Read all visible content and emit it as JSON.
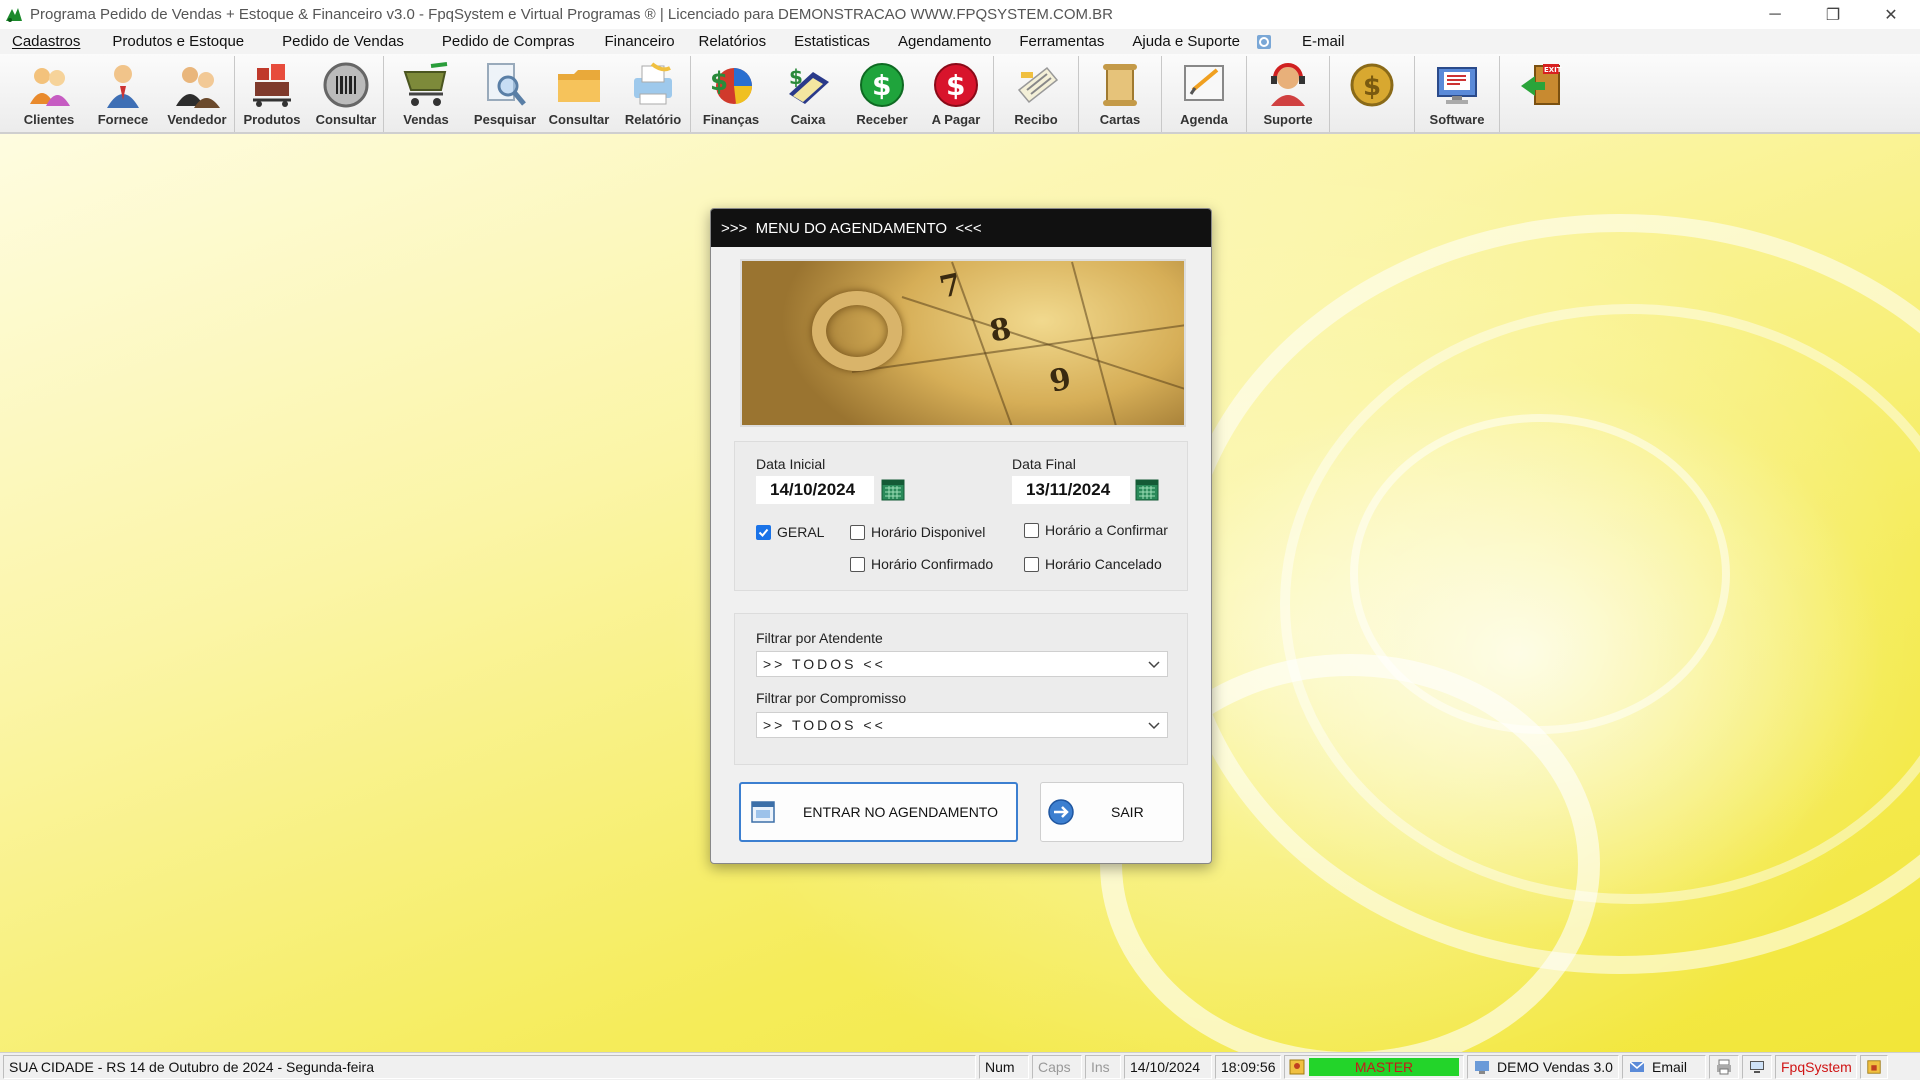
{
  "window": {
    "title": "Programa Pedido de Vendas + Estoque & Financeiro v3.0 - FpqSystem e Virtual Programas ® | Licenciado para  DEMONSTRACAO WWW.FPQSYSTEM.COM.BR",
    "controls": {
      "minimize": "─",
      "restore": "❐",
      "close": "✕"
    }
  },
  "menu": {
    "items": [
      "Cadastros",
      "Produtos e Estoque",
      "Pedido de Vendas",
      "Pedido de Compras",
      "Financeiro",
      "Relatórios",
      "Estatisticas",
      "Agendamento",
      "Ferramentas",
      "Ajuda e Suporte"
    ],
    "email": "E-mail"
  },
  "toolbar": {
    "clientes": "Clientes",
    "fornece": "Fornece",
    "vendedor": "Vendedor",
    "produtos": "Produtos",
    "consultar1": "Consultar",
    "vendas": "Vendas",
    "pesquisar": "Pesquisar",
    "consultar2": "Consultar",
    "relatorio": "Relatório",
    "financas": "Finanças",
    "caixa": "Caixa",
    "receber": "Receber",
    "apagar": "A Pagar",
    "recibo": "Recibo",
    "cartas": "Cartas",
    "agenda": "Agenda",
    "suporte": "Suporte",
    "software": "Software"
  },
  "dialog": {
    "title": ">>>  MENU DO AGENDAMENTO  <<<",
    "banner_numbers": [
      "7",
      "8",
      "9"
    ],
    "data_inicial_label": "Data Inicial",
    "data_inicial": "14/10/2024",
    "data_final_label": "Data Final",
    "data_final": "13/11/2024",
    "checkboxes": {
      "geral": {
        "label": "GERAL",
        "checked": true
      },
      "disponivel": {
        "label": "Horário  Disponivel",
        "checked": false
      },
      "confirmar": {
        "label": "Horário a Confirmar",
        "checked": false
      },
      "confirmado": {
        "label": "Horário Confirmado",
        "checked": false
      },
      "cancelado": {
        "label": "Horário Cancelado",
        "checked": false
      }
    },
    "atendente_label": "Filtrar por Atendente",
    "atendente_value": ">> TODOS <<",
    "compromisso_label": "Filtrar por Compromisso",
    "compromisso_value": ">> TODOS <<",
    "entrar_label": "ENTRAR NO AGENDAMENTO",
    "sair_label": "SAIR"
  },
  "status": {
    "location": "SUA CIDADE - RS 14 de Outubro de 2024 - Segunda-feira",
    "num": "Num",
    "caps": "Caps",
    "ins": "Ins",
    "date": "14/10/2024",
    "time": "18:09:56",
    "user": "MASTER",
    "version": "DEMO Vendas 3.0",
    "email": "Email",
    "brand": "FpqSystem"
  },
  "colors": {
    "accent": "#3c7fd0",
    "master_bg": "#23d42a",
    "master_text": "#c41b1b",
    "brand": "#d01414"
  }
}
